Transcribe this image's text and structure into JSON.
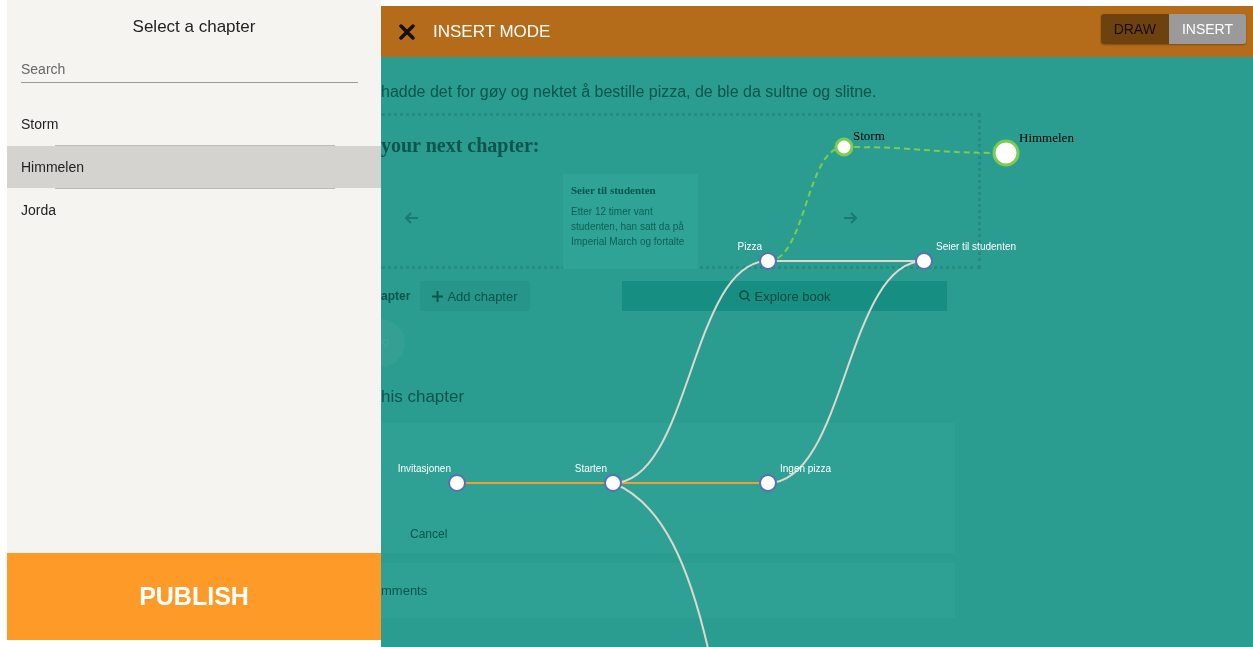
{
  "sidebar": {
    "title": "Select a chapter",
    "search": {
      "placeholder": "Search"
    },
    "items": [
      {
        "label": "Storm",
        "selected": false
      },
      {
        "label": "Himmelen",
        "selected": true
      },
      {
        "label": "Jorda",
        "selected": false
      }
    ],
    "publish_button": "PUBLISH"
  },
  "header": {
    "title": "INSERT MODE",
    "mode_toggle": [
      {
        "label": "DRAW",
        "selected": false
      },
      {
        "label": "INSERT",
        "selected": true
      }
    ]
  },
  "background_page": {
    "summary_text": "hadde det for gøy og nektet å bestille pizza, de ble da sultne og slitne.",
    "next_chapter_heading": "your next chapter:",
    "chapter_card": {
      "title": "Seier til studenten",
      "text": "Etter 12 timer vant studenten, han satt da på Imperial March og fortalte"
    },
    "chapter_label": "apter",
    "add_chapter_button": "Add chapter",
    "explore_button": "Explore book",
    "section_heading": "his chapter",
    "cancel_button": "Cancel",
    "comments_label": "mments"
  },
  "graph": {
    "nodes": [
      {
        "label": "Invitasjonen",
        "kind": "chapter"
      },
      {
        "label": "Starten",
        "kind": "chapter"
      },
      {
        "label": "Ingen pizza",
        "kind": "chapter"
      },
      {
        "label": "Pizza",
        "kind": "chapter"
      },
      {
        "label": "Seier til studenten",
        "kind": "chapter"
      },
      {
        "label": "Storm",
        "kind": "new"
      },
      {
        "label": "Himmelen",
        "kind": "new"
      }
    ],
    "edges": [
      {
        "kind": "path"
      },
      {
        "kind": "path"
      },
      {
        "kind": "link"
      },
      {
        "kind": "link"
      },
      {
        "kind": "link"
      },
      {
        "kind": "link"
      },
      {
        "kind": "draft"
      },
      {
        "kind": "draft"
      }
    ]
  }
}
